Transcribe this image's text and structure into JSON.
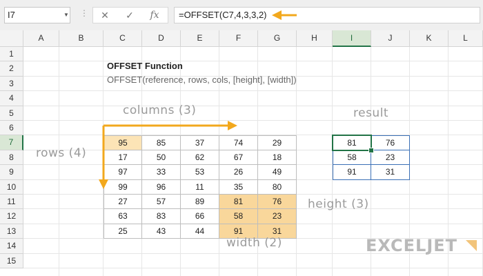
{
  "formula_bar": {
    "name_box": "I7",
    "cancel_icon": "✕",
    "enter_icon": "✓",
    "fx_icon": "fx",
    "formula": "=OFFSET(C7,4,3,3,2)"
  },
  "columns": [
    "A",
    "B",
    "C",
    "D",
    "E",
    "F",
    "G",
    "H",
    "I",
    "J",
    "K",
    "L"
  ],
  "rows": [
    "1",
    "2",
    "3",
    "4",
    "5",
    "6",
    "7",
    "8",
    "9",
    "10",
    "11",
    "12",
    "13",
    "14",
    "15"
  ],
  "active_cell": "I7",
  "sheet": {
    "title": "OFFSET Function",
    "syntax": "OFFSET(reference, rows, cols, [height], [width])",
    "table": [
      [
        "95",
        "85",
        "37",
        "74",
        "29"
      ],
      [
        "17",
        "50",
        "62",
        "67",
        "18"
      ],
      [
        "97",
        "33",
        "53",
        "26",
        "49"
      ],
      [
        "99",
        "96",
        "11",
        "35",
        "80"
      ],
      [
        "27",
        "57",
        "89",
        "81",
        "76"
      ],
      [
        "63",
        "83",
        "66",
        "58",
        "23"
      ],
      [
        "25",
        "43",
        "44",
        "91",
        "31"
      ]
    ],
    "result": [
      [
        "81",
        "76"
      ],
      [
        "58",
        "23"
      ],
      [
        "91",
        "31"
      ]
    ]
  },
  "annotations": {
    "columns": "columns (3)",
    "rows": "rows (4)",
    "result": "result",
    "height": "height (3)",
    "width": "width (2)"
  },
  "logo": "EXCELJET",
  "colors": {
    "arrow": "#f2a81d",
    "start_cell": "#fce4b6",
    "result_highlight": "#f9d79b",
    "result_border": "#3a6fb5",
    "selection": "#217346"
  }
}
